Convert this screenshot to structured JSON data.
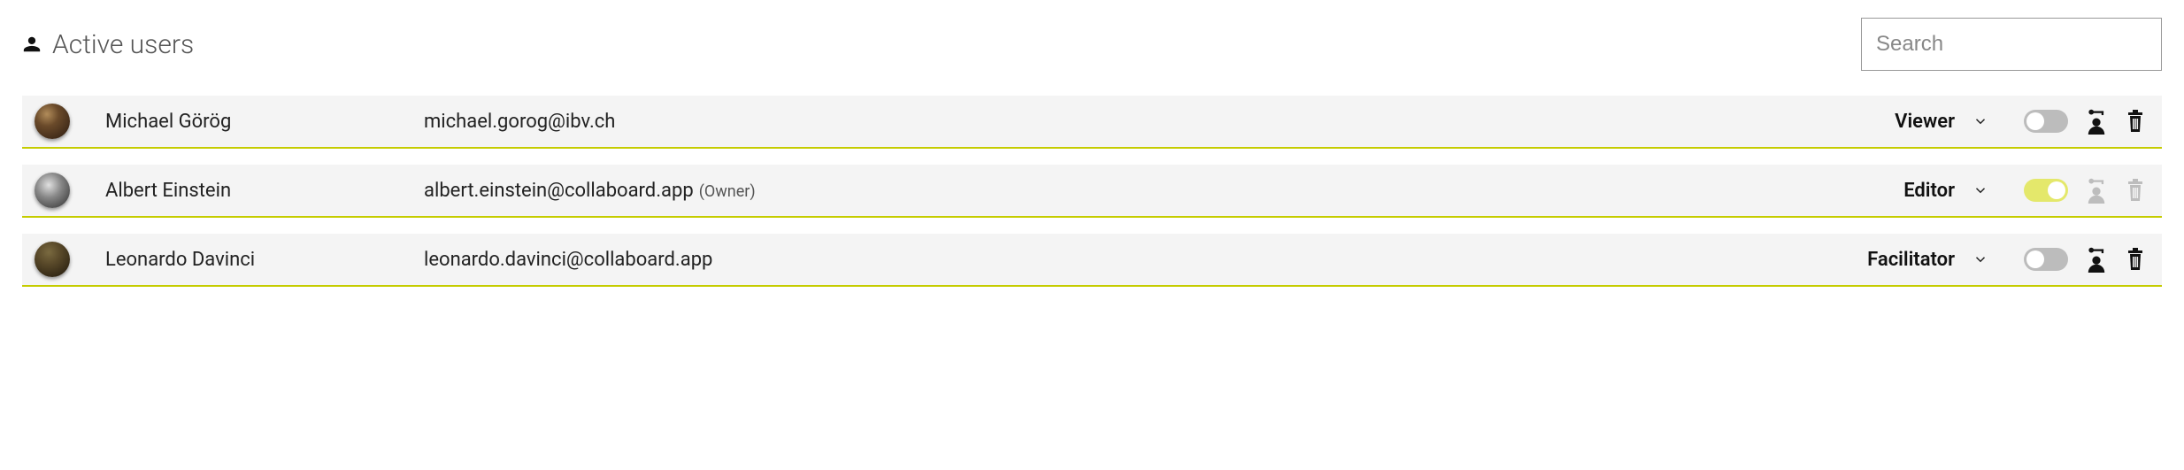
{
  "header": {
    "title": "Active users"
  },
  "search": {
    "placeholder": "Search",
    "value": ""
  },
  "owner_label": "(Owner)",
  "users": [
    {
      "name": "Michael Görög",
      "email": "michael.gorog@ibv.ch",
      "role": "Viewer",
      "avatar_bg": "radial-gradient(circle at 35% 30%, #b18c5a 0%, #6a4a2a 35%, #2a1a10 100%)",
      "is_owner": false,
      "toggle_on": false,
      "can_delete": true,
      "key_enabled": true
    },
    {
      "name": "Albert Einstein",
      "email": "albert.einstein@collaboard.app",
      "role": "Editor",
      "avatar_bg": "radial-gradient(circle at 40% 35%, #e0e0e0 0%, #888 40%, #2b2b2b 100%)",
      "is_owner": true,
      "toggle_on": true,
      "can_delete": false,
      "key_enabled": false
    },
    {
      "name": "Leonardo Davinci",
      "email": "leonardo.davinci@collaboard.app",
      "role": "Facilitator",
      "avatar_bg": "radial-gradient(circle at 40% 30%, #7a6a40 0%, #5a4a2a 35%, #1f170b 100%)",
      "is_owner": false,
      "toggle_on": false,
      "can_delete": true,
      "key_enabled": true
    }
  ]
}
